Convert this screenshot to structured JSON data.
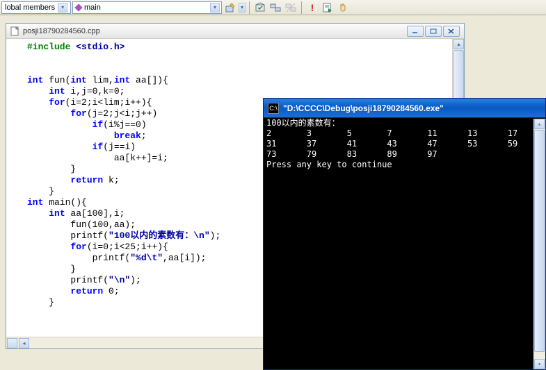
{
  "toolbar": {
    "scope_combo": "lobal members",
    "function_combo": "main"
  },
  "editor": {
    "filename": "posji18790284560.cpp",
    "code_lines": [
      {
        "indent": 0,
        "tokens": [
          {
            "t": "pp",
            "v": "#include"
          },
          {
            "t": "txt",
            "v": " "
          },
          {
            "t": "str",
            "v": "<stdio.h>"
          }
        ]
      },
      {
        "indent": 0,
        "tokens": []
      },
      {
        "indent": 0,
        "tokens": []
      },
      {
        "indent": 0,
        "tokens": [
          {
            "t": "kw",
            "v": "int"
          },
          {
            "t": "txt",
            "v": " fun("
          },
          {
            "t": "kw",
            "v": "int"
          },
          {
            "t": "txt",
            "v": " lim,"
          },
          {
            "t": "kw",
            "v": "int"
          },
          {
            "t": "txt",
            "v": " aa[]){"
          }
        ]
      },
      {
        "indent": 1,
        "tokens": [
          {
            "t": "kw",
            "v": "int"
          },
          {
            "t": "txt",
            "v": " i,j=0,k=0;"
          }
        ]
      },
      {
        "indent": 1,
        "tokens": [
          {
            "t": "kw",
            "v": "for"
          },
          {
            "t": "txt",
            "v": "(i=2;i<lim;i++){"
          }
        ]
      },
      {
        "indent": 2,
        "tokens": [
          {
            "t": "kw",
            "v": "for"
          },
          {
            "t": "txt",
            "v": "(j=2;j<i;j++)"
          }
        ]
      },
      {
        "indent": 3,
        "tokens": [
          {
            "t": "kw",
            "v": "if"
          },
          {
            "t": "txt",
            "v": "(i%j==0)"
          }
        ]
      },
      {
        "indent": 4,
        "tokens": [
          {
            "t": "kw",
            "v": "break"
          },
          {
            "t": "txt",
            "v": ";"
          }
        ]
      },
      {
        "indent": 3,
        "tokens": [
          {
            "t": "kw",
            "v": "if"
          },
          {
            "t": "txt",
            "v": "(j==i)"
          }
        ]
      },
      {
        "indent": 4,
        "tokens": [
          {
            "t": "txt",
            "v": "aa[k++]=i;"
          }
        ]
      },
      {
        "indent": 2,
        "tokens": [
          {
            "t": "txt",
            "v": "}"
          }
        ]
      },
      {
        "indent": 2,
        "tokens": [
          {
            "t": "kw",
            "v": "return"
          },
          {
            "t": "txt",
            "v": " k;"
          }
        ]
      },
      {
        "indent": 1,
        "tokens": [
          {
            "t": "txt",
            "v": "}"
          }
        ]
      },
      {
        "indent": 0,
        "tokens": [
          {
            "t": "kw",
            "v": "int"
          },
          {
            "t": "txt",
            "v": " main(){"
          }
        ]
      },
      {
        "indent": 1,
        "tokens": [
          {
            "t": "kw",
            "v": "int"
          },
          {
            "t": "txt",
            "v": " aa[100],i;"
          }
        ]
      },
      {
        "indent": 2,
        "tokens": [
          {
            "t": "txt",
            "v": "fun(100,aa);"
          }
        ]
      },
      {
        "indent": 2,
        "tokens": [
          {
            "t": "txt",
            "v": "printf("
          },
          {
            "t": "str",
            "v": "\"100以内的素数有：\\n\""
          },
          {
            "t": "txt",
            "v": ");"
          }
        ]
      },
      {
        "indent": 2,
        "tokens": [
          {
            "t": "kw",
            "v": "for"
          },
          {
            "t": "txt",
            "v": "(i=0;i<25;i++){"
          }
        ]
      },
      {
        "indent": 3,
        "tokens": [
          {
            "t": "txt",
            "v": "printf("
          },
          {
            "t": "str",
            "v": "\"%d\\t\""
          },
          {
            "t": "txt",
            "v": ",aa[i]);"
          }
        ]
      },
      {
        "indent": 2,
        "tokens": [
          {
            "t": "txt",
            "v": "}"
          }
        ]
      },
      {
        "indent": 2,
        "tokens": [
          {
            "t": "txt",
            "v": "printf("
          },
          {
            "t": "str",
            "v": "\"\\n\""
          },
          {
            "t": "txt",
            "v": ");"
          }
        ]
      },
      {
        "indent": 2,
        "tokens": [
          {
            "t": "kw",
            "v": "return"
          },
          {
            "t": "txt",
            "v": " 0;"
          }
        ]
      },
      {
        "indent": 1,
        "tokens": [
          {
            "t": "txt",
            "v": "}"
          }
        ]
      }
    ]
  },
  "console": {
    "title": "\"D:\\CCCC\\Debug\\posji18790284560.exe\"",
    "lines": [
      "100以内的素数有：",
      "2       3       5       7       11      13      17",
      "31      37      41      43      47      53      59",
      "73      79      83      89      97",
      "Press any key to continue"
    ]
  }
}
